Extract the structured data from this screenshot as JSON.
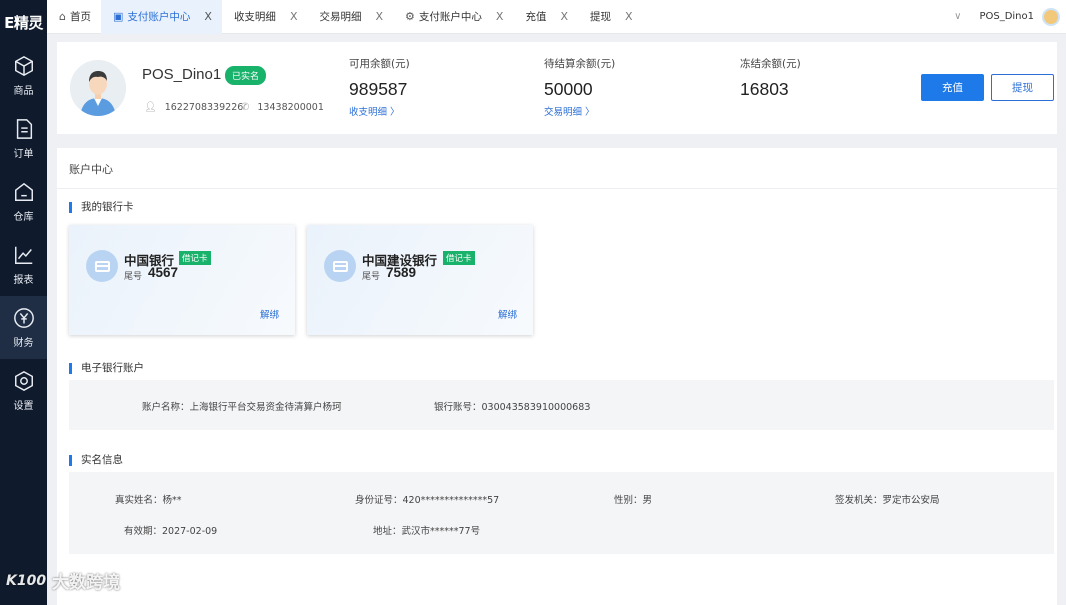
{
  "app": {
    "logo": "E精灵"
  },
  "sidebar": {
    "items": [
      {
        "label": "商品",
        "icon": "cube-icon",
        "active": false
      },
      {
        "label": "订单",
        "icon": "document-icon",
        "active": false
      },
      {
        "label": "仓库",
        "icon": "home-icon",
        "active": false
      },
      {
        "label": "报表",
        "icon": "chart-line-icon",
        "active": false
      },
      {
        "label": "财务",
        "icon": "yen-circle-icon",
        "active": true
      },
      {
        "label": "设置",
        "icon": "hexagon-gear-icon",
        "active": false
      }
    ]
  },
  "tabs": [
    {
      "label": "首页",
      "icon": "home-icon",
      "closable": false,
      "active": false
    },
    {
      "label": "支付账户中心",
      "icon": "id-card-icon",
      "closable": true,
      "active": true
    },
    {
      "label": "收支明细",
      "icon": "",
      "closable": true,
      "active": false
    },
    {
      "label": "交易明细",
      "icon": "",
      "closable": true,
      "active": false
    },
    {
      "label": "支付账户中心",
      "icon": "user-settings-icon",
      "closable": true,
      "active": false
    },
    {
      "label": "充值",
      "icon": "",
      "closable": true,
      "active": false
    },
    {
      "label": "提现",
      "icon": "",
      "closable": true,
      "active": false
    }
  ],
  "topbar": {
    "username": "POS_Dino1",
    "close_glyph": "X",
    "caret": "∨"
  },
  "profile": {
    "username": "POS_Dino1",
    "verified_badge": "已实名",
    "user_id": "1622708339226",
    "phone": "13438200001"
  },
  "balances": {
    "available": {
      "label": "可用余额(元)",
      "value": "989587",
      "link": "收支明细 〉"
    },
    "pending": {
      "label": "待结算余额(元)",
      "value": "50000",
      "link": "交易明细 〉"
    },
    "frozen": {
      "label": "冻结余额(元)",
      "value": "16803"
    }
  },
  "actions": {
    "recharge": "充值",
    "withdraw": "提现"
  },
  "main": {
    "title": "账户中心",
    "bank_cards_title": "我的银行卡",
    "bank_cards": [
      {
        "bank": "中国银行",
        "type": "借记卡",
        "tail_label": "尾号",
        "tail": "4567",
        "unbind": "解绑"
      },
      {
        "bank": "中国建设银行",
        "type": "借记卡",
        "tail_label": "尾号",
        "tail": "7589",
        "unbind": "解绑"
      }
    ],
    "ebank_title": "电子银行账户",
    "ebank": {
      "account_name": "账户名称：上海银行平台交易资金待清算户杨珂",
      "account_no": "银行账号：03004358391000068З"
    },
    "realname_title": "实名信息",
    "realname": {
      "name": "真实姓名：杨**",
      "id_no": "身份证号：420**************57",
      "gender": "性别：男",
      "issuer": "签发机关：罗定市公安局",
      "validity": "有效期：2027-02-09",
      "address": "地址：武汉市******77号"
    }
  },
  "watermark": {
    "logo": "K100",
    "text": "大数跨境"
  }
}
